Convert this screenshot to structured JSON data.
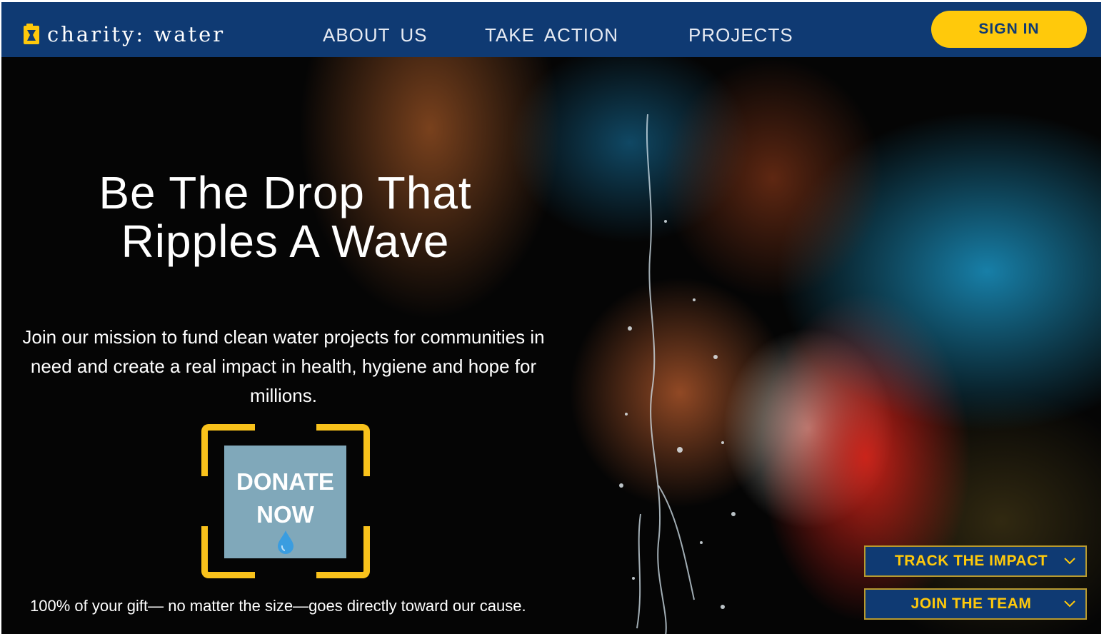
{
  "brand": {
    "name": "charity: water",
    "icon": "jerrycan-icon"
  },
  "nav": {
    "links": [
      "ABOUT US",
      "TAKE ACTION",
      "PROJECTS"
    ],
    "signin_label": "SIGN IN"
  },
  "hero": {
    "headline": "Be The Drop That Ripples A Wave",
    "subtext": "Join our mission to fund clean water projects for communities in need and create a real impact in health, hygiene and hope for millions.",
    "donate_label": "DONATE NOW",
    "donate_icon": "water-drop-icon",
    "gift_note": "100% of your gift— no matter the size—goes directly toward our cause."
  },
  "dropdowns": [
    {
      "label": "TRACK THE IMPACT",
      "icon": "chevron-down-icon"
    },
    {
      "label": "JOIN THE TEAM",
      "icon": "chevron-down-icon"
    }
  ],
  "colors": {
    "navy": "#0f3a73",
    "yellow": "#ffc90b",
    "donate_box": "#80a8ba",
    "frame": "#f9c21b"
  }
}
